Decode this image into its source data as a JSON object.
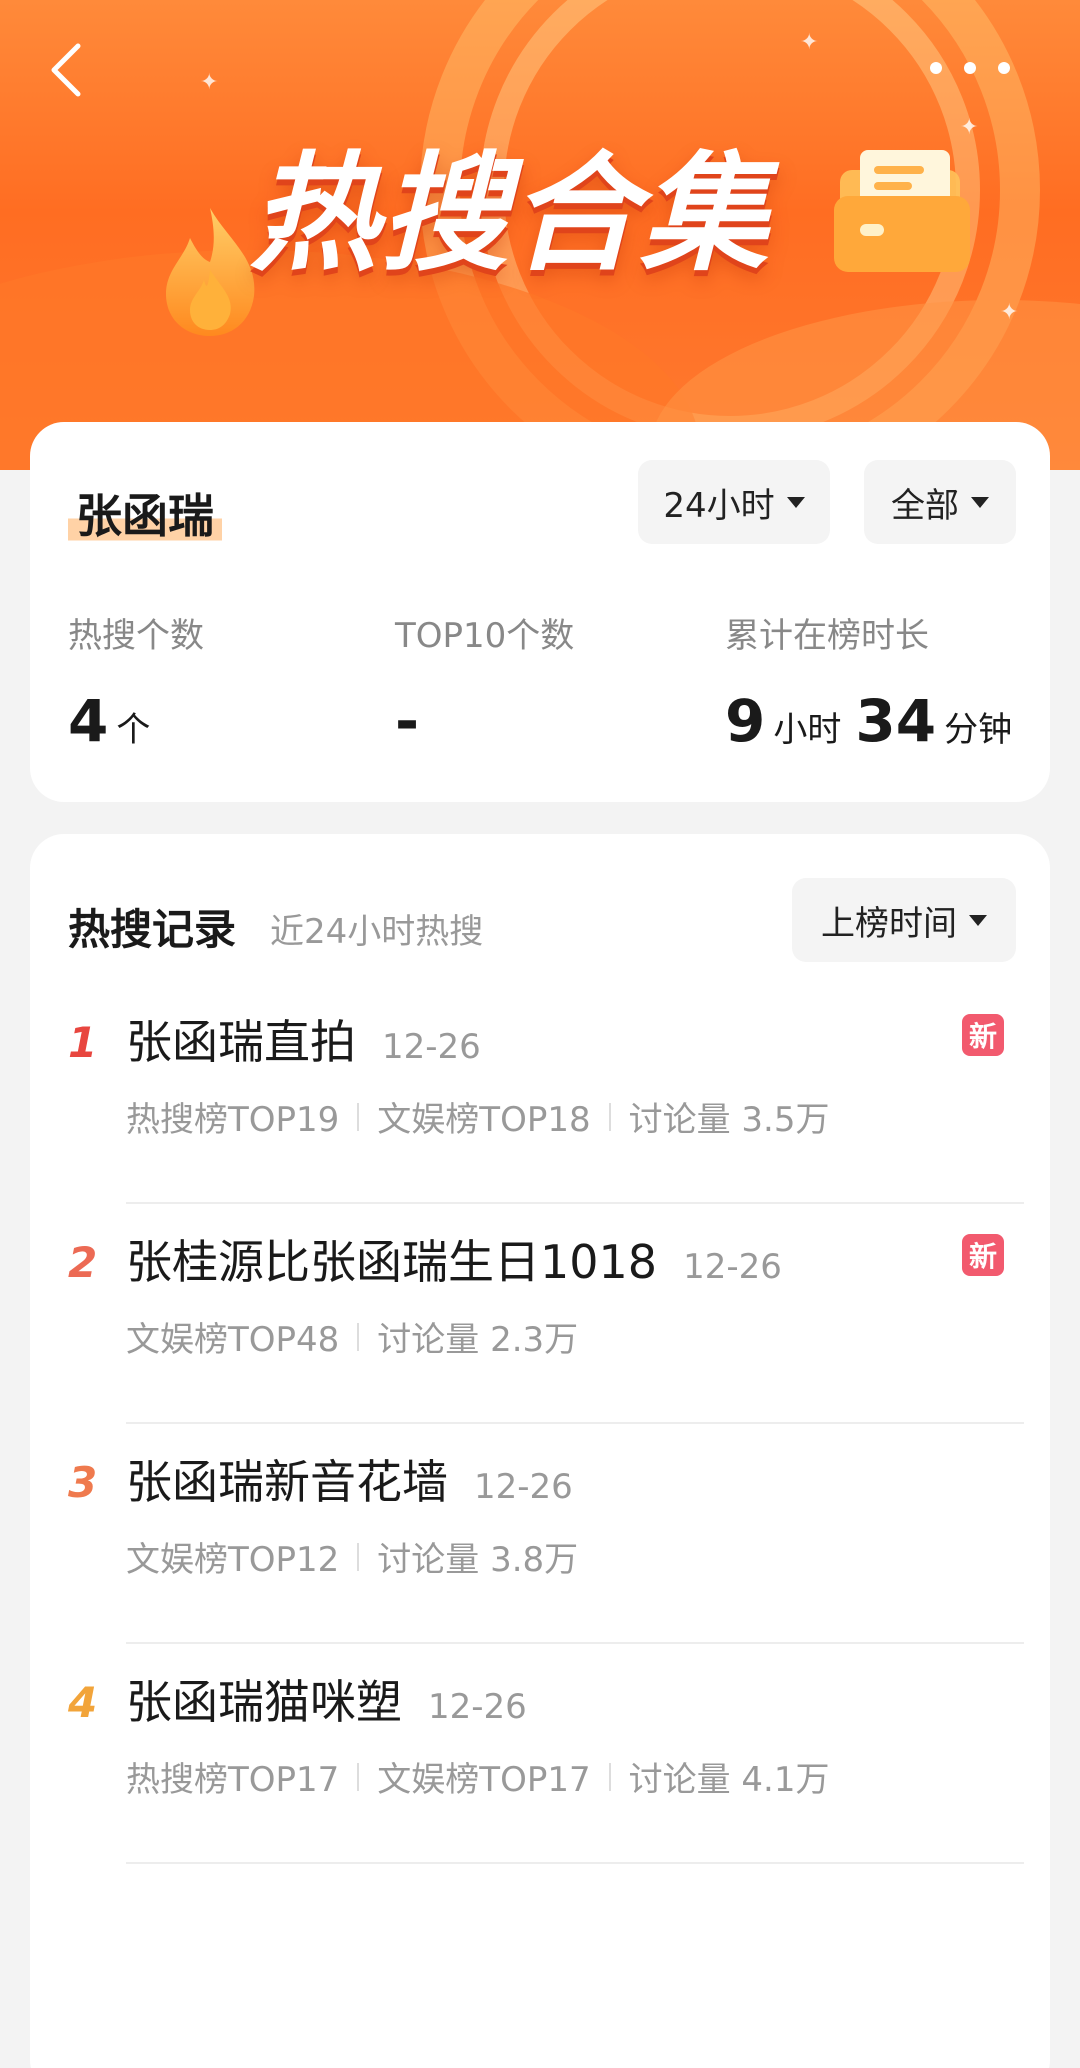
{
  "header": {
    "banner_title": "热搜合集",
    "back_icon": "chevron-left-icon",
    "more_icon": "more-dots-icon"
  },
  "summary": {
    "name": "张函瑞",
    "period_select": "24小时",
    "scope_select": "全部",
    "stats": {
      "count_label": "热搜个数",
      "count_value": "4",
      "count_unit": "个",
      "top10_label": "TOP10个数",
      "top10_value": "-",
      "duration_label": "累计在榜时长",
      "duration_hours": "9",
      "duration_hours_unit": "小时",
      "duration_minutes": "34",
      "duration_minutes_unit": "分钟"
    }
  },
  "records": {
    "title": "热搜记录",
    "subtitle": "近24小时热搜",
    "sort_select": "上榜时间",
    "items": [
      {
        "rank": "1",
        "rank_color": "#e8463f",
        "title": "张函瑞直拍",
        "date": "12-26",
        "badge": "新",
        "meta": [
          "热搜榜TOP19",
          "文娱榜TOP18",
          "讨论量 3.5万"
        ]
      },
      {
        "rank": "2",
        "rank_color": "#ec6a54",
        "title": "张桂源比张函瑞生日1018",
        "date": "12-26",
        "badge": "新",
        "meta": [
          "文娱榜TOP48",
          "讨论量 2.3万"
        ]
      },
      {
        "rank": "3",
        "rank_color": "#ef7a4e",
        "title": "张函瑞新音花墙",
        "date": "12-26",
        "badge": "",
        "meta": [
          "文娱榜TOP12",
          "讨论量 3.8万"
        ]
      },
      {
        "rank": "4",
        "rank_color": "#f2a43a",
        "title": "张函瑞猫咪塑",
        "date": "12-26",
        "badge": "",
        "meta": [
          "热搜榜TOP17",
          "文娱榜TOP17",
          "讨论量 4.1万"
        ]
      }
    ]
  },
  "colors": {
    "banner_orange": "#ff7a30",
    "badge_new": "#f25a6e",
    "name_highlight": "#ffd2a6"
  }
}
